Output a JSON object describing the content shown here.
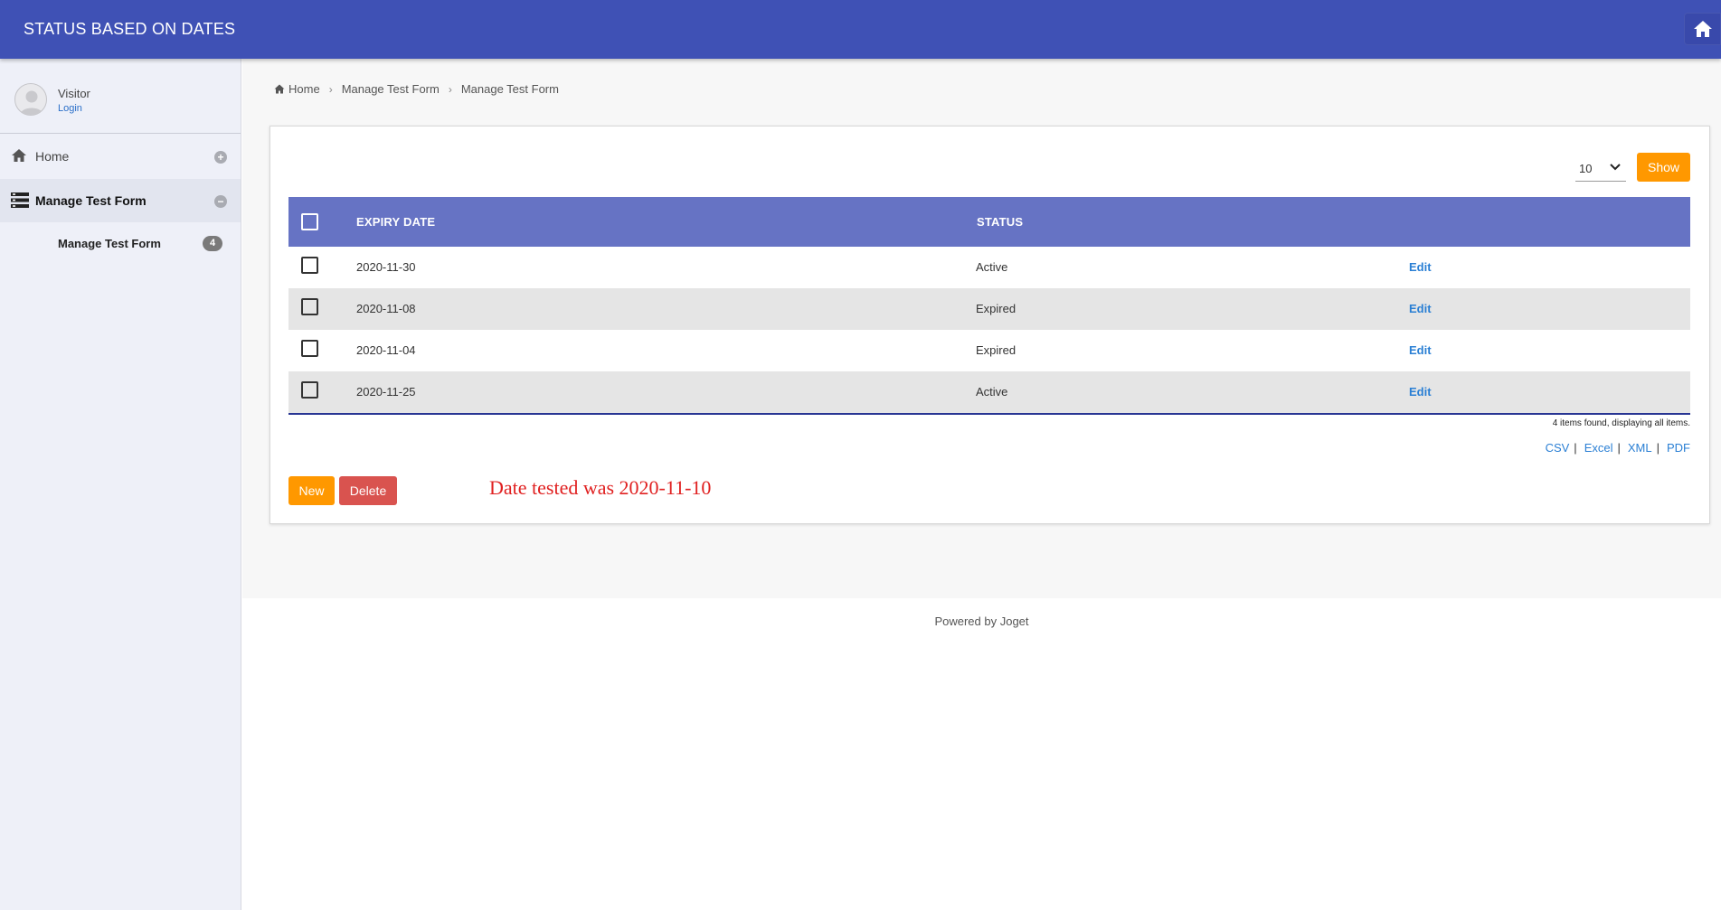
{
  "header": {
    "app_title": "STATUS BASED ON DATES",
    "home_icon": "home-icon"
  },
  "sidebar": {
    "user": {
      "name": "Visitor",
      "login_label": "Login"
    },
    "items": [
      {
        "label": "Home",
        "icon": "home-icon",
        "toggle": "+"
      },
      {
        "label": "Manage Test Form",
        "icon": "list-icon",
        "toggle": "−"
      }
    ],
    "sub_items": [
      {
        "label": "Manage Test Form",
        "count": "4"
      }
    ]
  },
  "breadcrumb": [
    "Home",
    "Manage Test Form",
    "Manage Test Form"
  ],
  "list": {
    "page_size": "10",
    "show_label": "Show",
    "columns": [
      "EXPIRY DATE",
      "STATUS"
    ],
    "rows": [
      {
        "expiry_date": "2020-11-30",
        "status": "Active",
        "action": "Edit"
      },
      {
        "expiry_date": "2020-11-08",
        "status": "Expired",
        "action": "Edit"
      },
      {
        "expiry_date": "2020-11-04",
        "status": "Expired",
        "action": "Edit"
      },
      {
        "expiry_date": "2020-11-25",
        "status": "Active",
        "action": "Edit"
      }
    ],
    "found_text": "4 items found, displaying all items.",
    "exports": [
      "CSV",
      "Excel",
      "XML",
      "PDF"
    ],
    "new_label": "New",
    "delete_label": "Delete"
  },
  "note": "Date tested was 2020-11-10",
  "footer": "Powered by Joget",
  "colors": {
    "header": "#3f51b5",
    "table_header": "#6673c4",
    "accent_orange": "#ff9800",
    "delete_red": "#d9534f",
    "link_blue": "#2a7fd4",
    "note_red": "#e02020"
  }
}
